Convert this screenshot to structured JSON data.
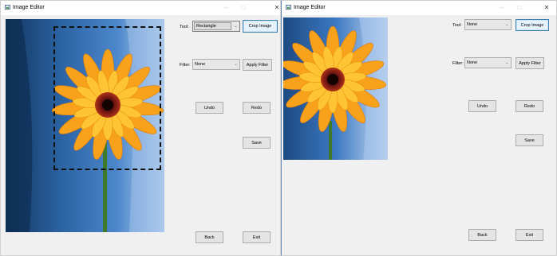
{
  "left_window": {
    "title": "Image Editor",
    "controls": {
      "minimize": "–",
      "maximize": "□",
      "close": "✕"
    },
    "tool": {
      "label": "Tool:",
      "value": "Rectangle"
    },
    "crop_button": "Crop Image",
    "filter": {
      "label": "Filter:",
      "value": "None"
    },
    "apply_filter_button": "Apply Filter",
    "undo_button": "Undo",
    "redo_button": "Redo",
    "save_button": "Save",
    "back_button": "Back",
    "exit_button": "Exit"
  },
  "right_window": {
    "title": "Image Editor",
    "controls": {
      "minimize": "–",
      "maximize": "□",
      "close": "✕"
    },
    "tool": {
      "label": "Tool:",
      "value": "None"
    },
    "crop_button": "Crop Image",
    "filter": {
      "label": "Filter:",
      "value": "None"
    },
    "apply_filter_button": "Apply Filter",
    "undo_button": "Undo",
    "redo_button": "Redo",
    "save_button": "Save",
    "back_button": "Back",
    "exit_button": "Exit"
  },
  "icons": [
    "image-editor-app-icon",
    "combo-arrow-icon"
  ],
  "colors": {
    "window_bg": "#f0f0f0",
    "focus_border": "#3c7fb1",
    "flower_petal": "#f7a21a",
    "flower_center": "#7a1515",
    "sky_blue": "#1f4c80"
  }
}
